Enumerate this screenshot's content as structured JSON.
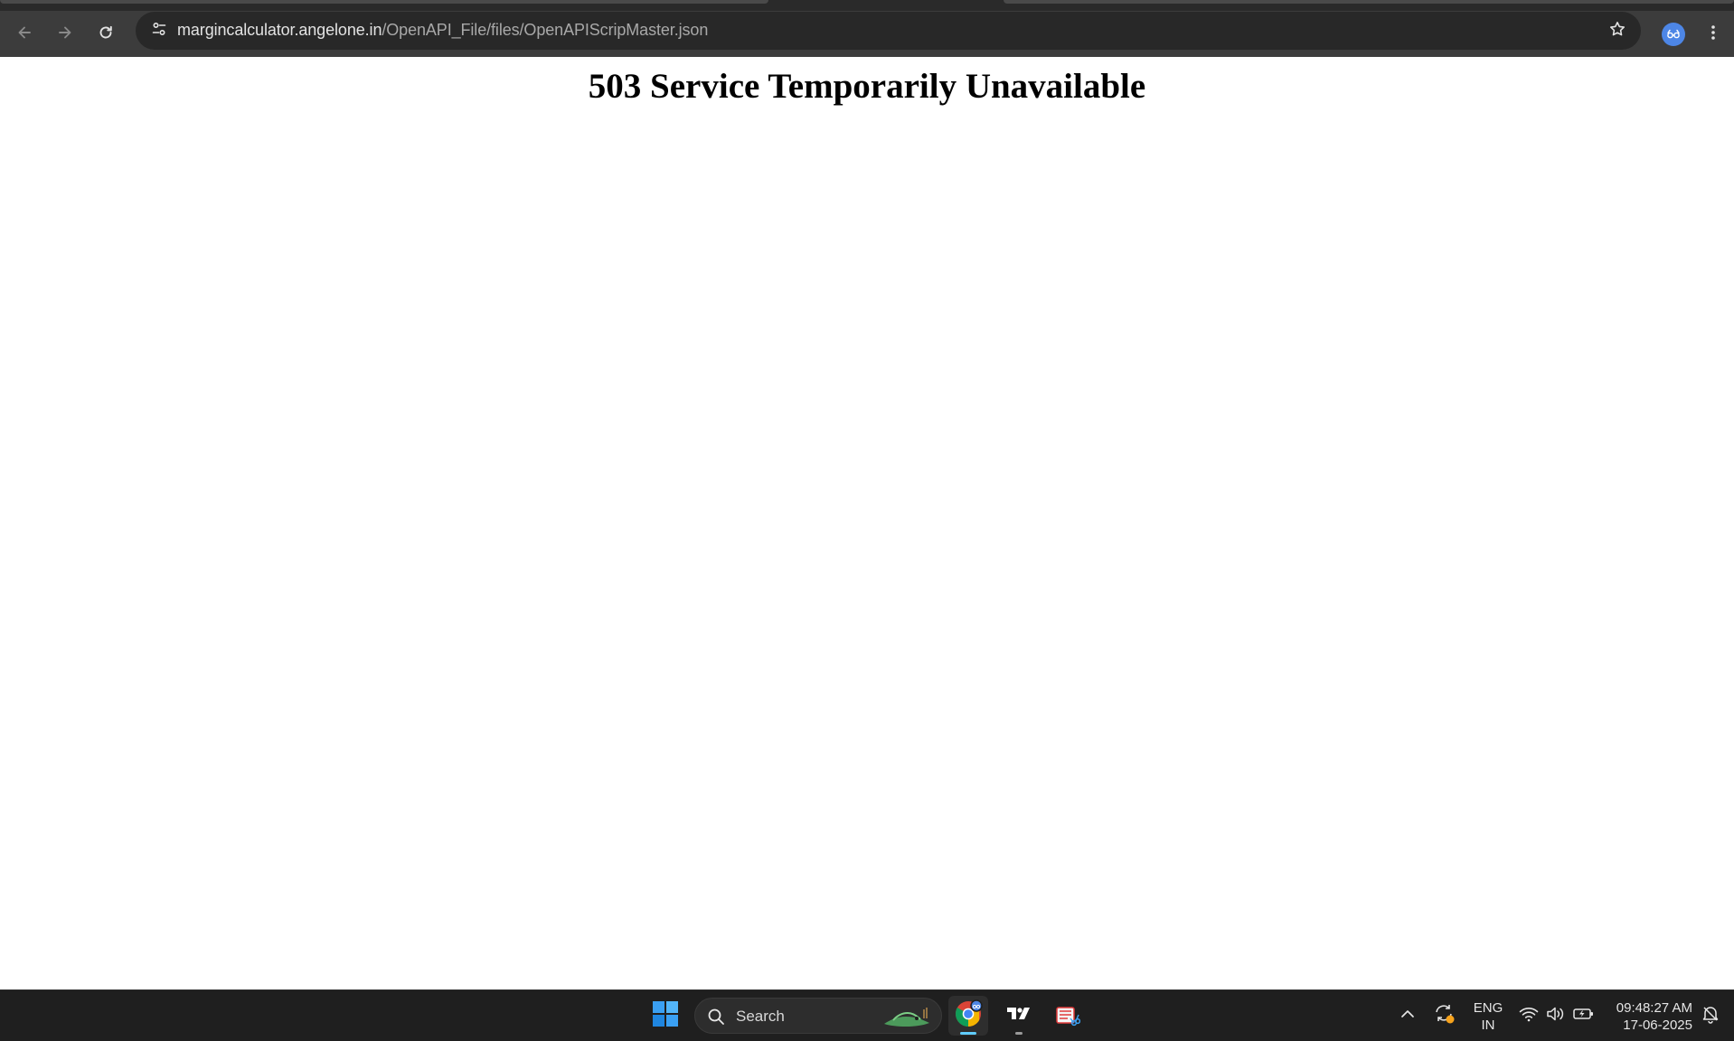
{
  "browser": {
    "url_host": "margincalculator.angelone.in",
    "url_path": "/OpenAPI_File/files/OpenAPIScripMaster.json",
    "icons": {
      "back": "arrow-left-icon",
      "forward": "arrow-right-icon",
      "reload": "reload-icon",
      "site_info": "tune-icon",
      "bookmark": "star-icon",
      "profile": "avatar-icon",
      "menu": "kebab-menu-icon"
    },
    "colors": {
      "toolbar": "#3c3c3c",
      "omnibox": "#282828",
      "avatar": "#4d86e6"
    }
  },
  "page": {
    "heading": "503 Service Temporarily Unavailable"
  },
  "taskbar": {
    "search_label": "Search",
    "apps": [
      "windows-start-icon",
      "chrome-icon",
      "tradingview-icon",
      "snipping-tool-icon"
    ],
    "language_line1": "ENG",
    "language_line2": "IN",
    "time": "09:48:27 AM",
    "date": "17-06-2025",
    "colors": {
      "background": "#1f1f1f",
      "accent": "#60cdff"
    }
  }
}
